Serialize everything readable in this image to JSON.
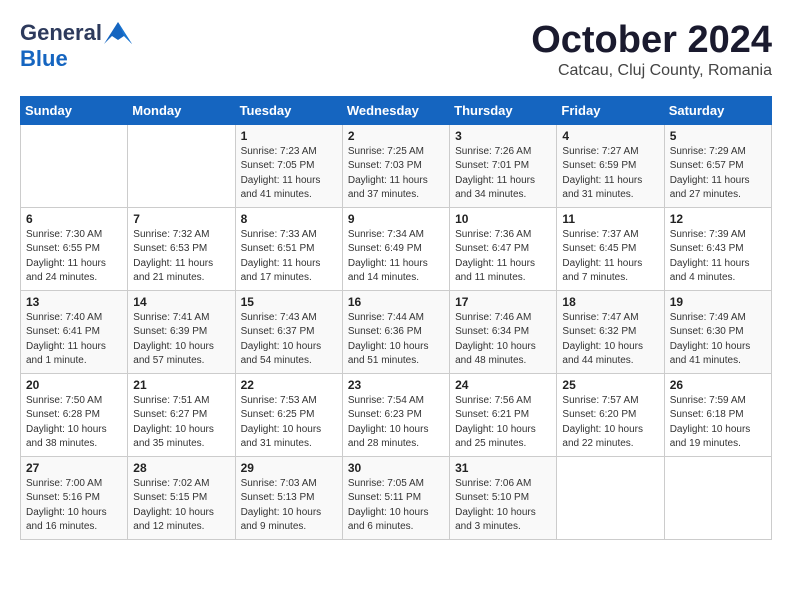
{
  "logo": {
    "general": "General",
    "blue": "Blue"
  },
  "header": {
    "month_title": "October 2024",
    "subtitle": "Catcau, Cluj County, Romania"
  },
  "days_of_week": [
    "Sunday",
    "Monday",
    "Tuesday",
    "Wednesday",
    "Thursday",
    "Friday",
    "Saturday"
  ],
  "weeks": [
    [
      {
        "day": "",
        "sunrise": "",
        "sunset": "",
        "daylight": ""
      },
      {
        "day": "",
        "sunrise": "",
        "sunset": "",
        "daylight": ""
      },
      {
        "day": "1",
        "sunrise": "Sunrise: 7:23 AM",
        "sunset": "Sunset: 7:05 PM",
        "daylight": "Daylight: 11 hours and 41 minutes."
      },
      {
        "day": "2",
        "sunrise": "Sunrise: 7:25 AM",
        "sunset": "Sunset: 7:03 PM",
        "daylight": "Daylight: 11 hours and 37 minutes."
      },
      {
        "day": "3",
        "sunrise": "Sunrise: 7:26 AM",
        "sunset": "Sunset: 7:01 PM",
        "daylight": "Daylight: 11 hours and 34 minutes."
      },
      {
        "day": "4",
        "sunrise": "Sunrise: 7:27 AM",
        "sunset": "Sunset: 6:59 PM",
        "daylight": "Daylight: 11 hours and 31 minutes."
      },
      {
        "day": "5",
        "sunrise": "Sunrise: 7:29 AM",
        "sunset": "Sunset: 6:57 PM",
        "daylight": "Daylight: 11 hours and 27 minutes."
      }
    ],
    [
      {
        "day": "6",
        "sunrise": "Sunrise: 7:30 AM",
        "sunset": "Sunset: 6:55 PM",
        "daylight": "Daylight: 11 hours and 24 minutes."
      },
      {
        "day": "7",
        "sunrise": "Sunrise: 7:32 AM",
        "sunset": "Sunset: 6:53 PM",
        "daylight": "Daylight: 11 hours and 21 minutes."
      },
      {
        "day": "8",
        "sunrise": "Sunrise: 7:33 AM",
        "sunset": "Sunset: 6:51 PM",
        "daylight": "Daylight: 11 hours and 17 minutes."
      },
      {
        "day": "9",
        "sunrise": "Sunrise: 7:34 AM",
        "sunset": "Sunset: 6:49 PM",
        "daylight": "Daylight: 11 hours and 14 minutes."
      },
      {
        "day": "10",
        "sunrise": "Sunrise: 7:36 AM",
        "sunset": "Sunset: 6:47 PM",
        "daylight": "Daylight: 11 hours and 11 minutes."
      },
      {
        "day": "11",
        "sunrise": "Sunrise: 7:37 AM",
        "sunset": "Sunset: 6:45 PM",
        "daylight": "Daylight: 11 hours and 7 minutes."
      },
      {
        "day": "12",
        "sunrise": "Sunrise: 7:39 AM",
        "sunset": "Sunset: 6:43 PM",
        "daylight": "Daylight: 11 hours and 4 minutes."
      }
    ],
    [
      {
        "day": "13",
        "sunrise": "Sunrise: 7:40 AM",
        "sunset": "Sunset: 6:41 PM",
        "daylight": "Daylight: 11 hours and 1 minute."
      },
      {
        "day": "14",
        "sunrise": "Sunrise: 7:41 AM",
        "sunset": "Sunset: 6:39 PM",
        "daylight": "Daylight: 10 hours and 57 minutes."
      },
      {
        "day": "15",
        "sunrise": "Sunrise: 7:43 AM",
        "sunset": "Sunset: 6:37 PM",
        "daylight": "Daylight: 10 hours and 54 minutes."
      },
      {
        "day": "16",
        "sunrise": "Sunrise: 7:44 AM",
        "sunset": "Sunset: 6:36 PM",
        "daylight": "Daylight: 10 hours and 51 minutes."
      },
      {
        "day": "17",
        "sunrise": "Sunrise: 7:46 AM",
        "sunset": "Sunset: 6:34 PM",
        "daylight": "Daylight: 10 hours and 48 minutes."
      },
      {
        "day": "18",
        "sunrise": "Sunrise: 7:47 AM",
        "sunset": "Sunset: 6:32 PM",
        "daylight": "Daylight: 10 hours and 44 minutes."
      },
      {
        "day": "19",
        "sunrise": "Sunrise: 7:49 AM",
        "sunset": "Sunset: 6:30 PM",
        "daylight": "Daylight: 10 hours and 41 minutes."
      }
    ],
    [
      {
        "day": "20",
        "sunrise": "Sunrise: 7:50 AM",
        "sunset": "Sunset: 6:28 PM",
        "daylight": "Daylight: 10 hours and 38 minutes."
      },
      {
        "day": "21",
        "sunrise": "Sunrise: 7:51 AM",
        "sunset": "Sunset: 6:27 PM",
        "daylight": "Daylight: 10 hours and 35 minutes."
      },
      {
        "day": "22",
        "sunrise": "Sunrise: 7:53 AM",
        "sunset": "Sunset: 6:25 PM",
        "daylight": "Daylight: 10 hours and 31 minutes."
      },
      {
        "day": "23",
        "sunrise": "Sunrise: 7:54 AM",
        "sunset": "Sunset: 6:23 PM",
        "daylight": "Daylight: 10 hours and 28 minutes."
      },
      {
        "day": "24",
        "sunrise": "Sunrise: 7:56 AM",
        "sunset": "Sunset: 6:21 PM",
        "daylight": "Daylight: 10 hours and 25 minutes."
      },
      {
        "day": "25",
        "sunrise": "Sunrise: 7:57 AM",
        "sunset": "Sunset: 6:20 PM",
        "daylight": "Daylight: 10 hours and 22 minutes."
      },
      {
        "day": "26",
        "sunrise": "Sunrise: 7:59 AM",
        "sunset": "Sunset: 6:18 PM",
        "daylight": "Daylight: 10 hours and 19 minutes."
      }
    ],
    [
      {
        "day": "27",
        "sunrise": "Sunrise: 7:00 AM",
        "sunset": "Sunset: 5:16 PM",
        "daylight": "Daylight: 10 hours and 16 minutes."
      },
      {
        "day": "28",
        "sunrise": "Sunrise: 7:02 AM",
        "sunset": "Sunset: 5:15 PM",
        "daylight": "Daylight: 10 hours and 12 minutes."
      },
      {
        "day": "29",
        "sunrise": "Sunrise: 7:03 AM",
        "sunset": "Sunset: 5:13 PM",
        "daylight": "Daylight: 10 hours and 9 minutes."
      },
      {
        "day": "30",
        "sunrise": "Sunrise: 7:05 AM",
        "sunset": "Sunset: 5:11 PM",
        "daylight": "Daylight: 10 hours and 6 minutes."
      },
      {
        "day": "31",
        "sunrise": "Sunrise: 7:06 AM",
        "sunset": "Sunset: 5:10 PM",
        "daylight": "Daylight: 10 hours and 3 minutes."
      },
      {
        "day": "",
        "sunrise": "",
        "sunset": "",
        "daylight": ""
      },
      {
        "day": "",
        "sunrise": "",
        "sunset": "",
        "daylight": ""
      }
    ]
  ]
}
